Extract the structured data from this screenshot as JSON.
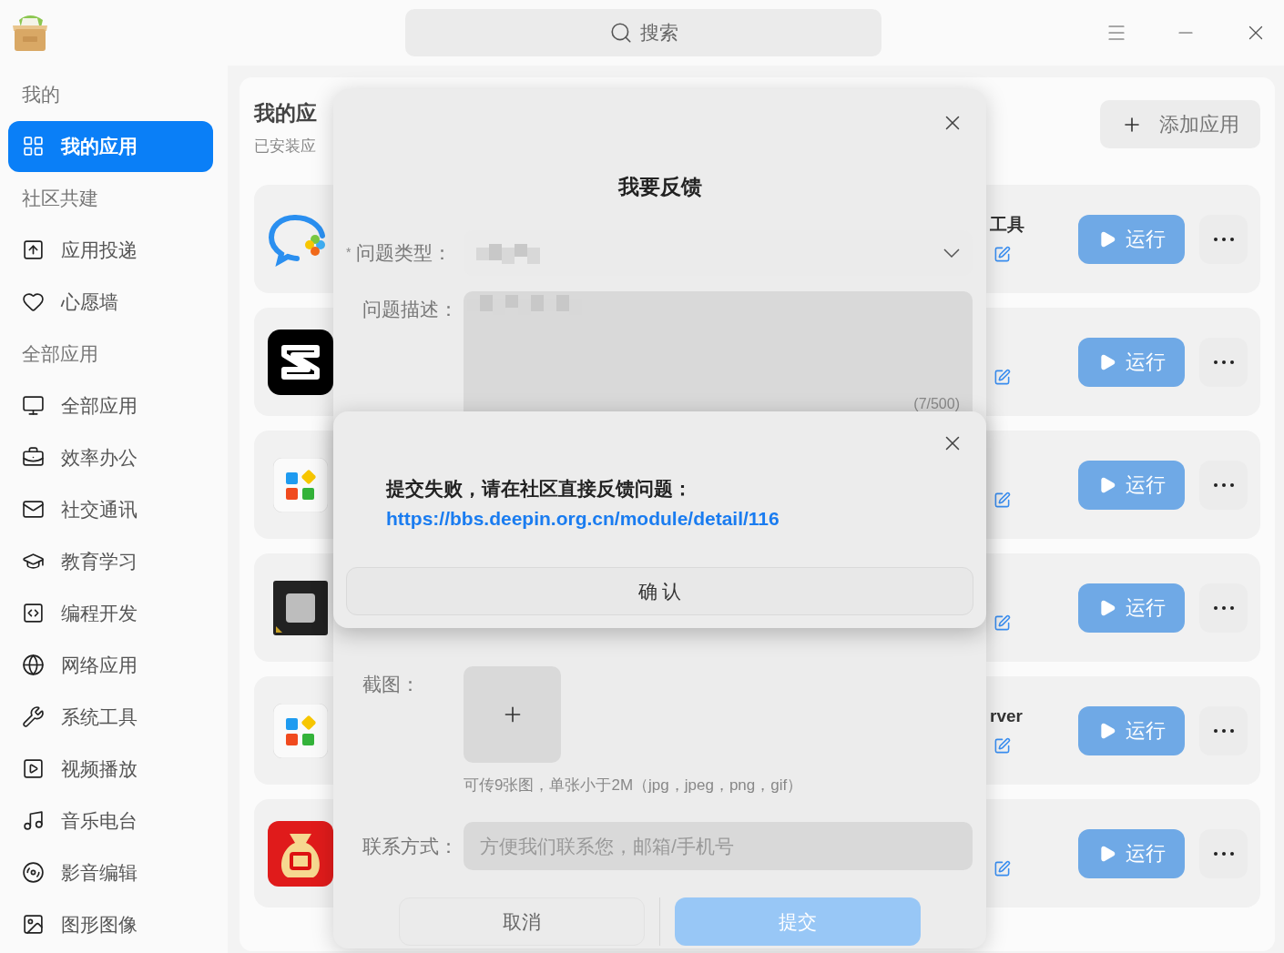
{
  "search": {
    "placeholder": "搜索"
  },
  "sidebar": {
    "items": [
      {
        "kind": "header",
        "label": "我的"
      },
      {
        "kind": "item",
        "label": "我的应用",
        "selected": true
      },
      {
        "kind": "header",
        "label": "社区共建"
      },
      {
        "kind": "item",
        "label": "应用投递",
        "selected": false
      },
      {
        "kind": "item",
        "label": "心愿墙",
        "selected": false
      },
      {
        "kind": "header",
        "label": "全部应用"
      },
      {
        "kind": "item",
        "label": "全部应用",
        "selected": false
      },
      {
        "kind": "item",
        "label": "效率办公",
        "selected": false
      },
      {
        "kind": "item",
        "label": "社交通讯",
        "selected": false
      },
      {
        "kind": "item",
        "label": "教育学习",
        "selected": false
      },
      {
        "kind": "item",
        "label": "编程开发",
        "selected": false
      },
      {
        "kind": "item",
        "label": "网络应用",
        "selected": false
      },
      {
        "kind": "item",
        "label": "系统工具",
        "selected": false
      },
      {
        "kind": "item",
        "label": "视频播放",
        "selected": false
      },
      {
        "kind": "item",
        "label": "音乐电台",
        "selected": false
      },
      {
        "kind": "item",
        "label": "影音编辑",
        "selected": false
      },
      {
        "kind": "item",
        "label": "图形图像",
        "selected": false
      }
    ]
  },
  "main": {
    "title": "我的应",
    "subtitle": "已安装应",
    "add_button": "添加应用"
  },
  "apps": [
    {
      "name": "工具",
      "run_label": "运行"
    },
    {
      "run_label": "运行"
    },
    {
      "run_label": "运行"
    },
    {
      "run_label": "运行"
    },
    {
      "name": "rver",
      "run_label": "运行"
    },
    {
      "run_label": "运行"
    }
  ],
  "feedback_dialog": {
    "title": "我要反馈",
    "type_field": {
      "required_mark": "*",
      "label": "问题类型："
    },
    "description_field": {
      "label": "问题描述：",
      "counter": "(7/500)"
    },
    "screenshot_field": {
      "label": "截图：",
      "hint": "可传9张图，单张小于2M（jpg，jpeg，png，gif）"
    },
    "contact_field": {
      "label": "联系方式：",
      "placeholder": "方便我们联系您，邮箱/手机号"
    },
    "cancel_button": "取消",
    "submit_button": "提交"
  },
  "error_dialog": {
    "message": "提交失败，请在社区直接反馈问题：",
    "link": "https://bbs.deepin.org.cn/module/detail/116",
    "confirm_button": "确 认"
  }
}
